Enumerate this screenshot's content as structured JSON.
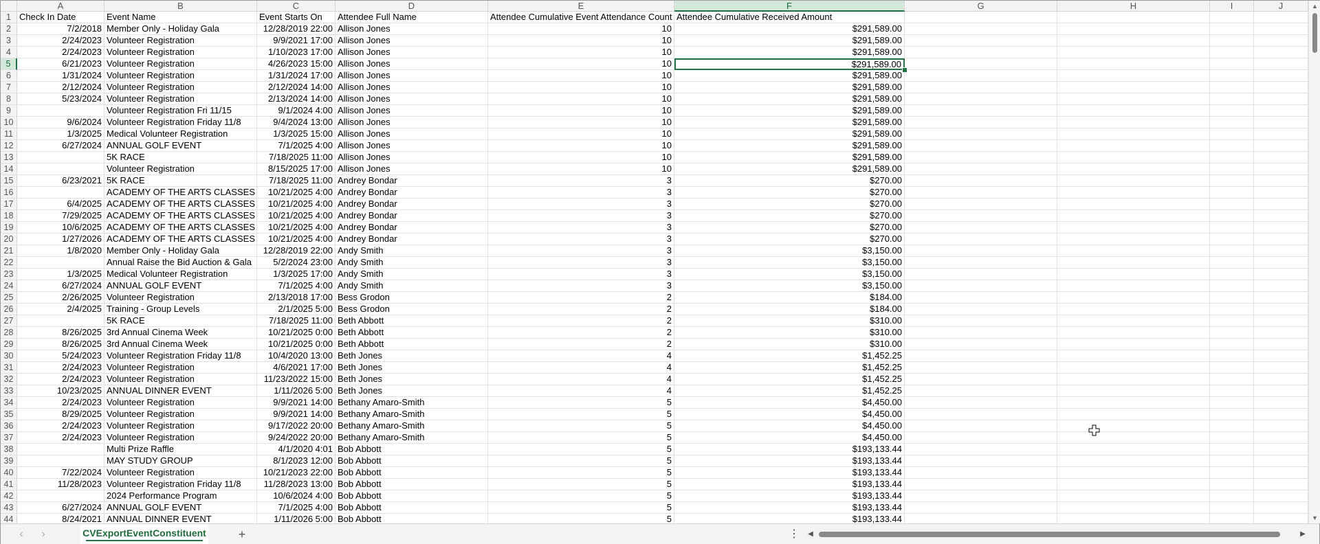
{
  "sheet": {
    "columns": [
      "A",
      "B",
      "C",
      "D",
      "E",
      "F",
      "G",
      "H",
      "I",
      "J"
    ],
    "active_column": "F",
    "active_row": "5",
    "selected_cell": "F5",
    "rows": [
      {
        "n": "1",
        "a": "Check In Date",
        "b": "Event Name",
        "c": "Event Starts On",
        "d": "Attendee Full Name",
        "e": "Attendee Cumulative Event Attendance Count",
        "f": "Attendee Cumulative Received Amount"
      },
      {
        "n": "2",
        "a": "7/2/2018",
        "b": "Member Only - Holiday Gala",
        "c": "12/28/2019 22:00",
        "d": "Allison Jones",
        "e": "10",
        "f": "$291,589.00"
      },
      {
        "n": "3",
        "a": "2/24/2023",
        "b": "Volunteer Registration",
        "c": "9/9/2021 17:00",
        "d": "Allison Jones",
        "e": "10",
        "f": "$291,589.00"
      },
      {
        "n": "4",
        "a": "2/24/2023",
        "b": "Volunteer Registration",
        "c": "1/10/2023 17:00",
        "d": "Allison Jones",
        "e": "10",
        "f": "$291,589.00"
      },
      {
        "n": "5",
        "a": "6/21/2023",
        "b": "Volunteer Registration",
        "c": "4/26/2023 15:00",
        "d": "Allison Jones",
        "e": "10",
        "f": "$291,589.00"
      },
      {
        "n": "6",
        "a": "1/31/2024",
        "b": "Volunteer Registration",
        "c": "1/31/2024 17:00",
        "d": "Allison Jones",
        "e": "10",
        "f": "$291,589.00"
      },
      {
        "n": "7",
        "a": "2/12/2024",
        "b": "Volunteer Registration",
        "c": "2/12/2024 14:00",
        "d": "Allison Jones",
        "e": "10",
        "f": "$291,589.00"
      },
      {
        "n": "8",
        "a": "5/23/2024",
        "b": "Volunteer Registration",
        "c": "2/13/2024 14:00",
        "d": "Allison Jones",
        "e": "10",
        "f": "$291,589.00"
      },
      {
        "n": "9",
        "a": "",
        "b": "Volunteer Registration Fri 11/15",
        "c": "9/1/2024 4:00",
        "d": "Allison Jones",
        "e": "10",
        "f": "$291,589.00"
      },
      {
        "n": "10",
        "a": "9/6/2024",
        "b": "Volunteer Registration Friday 11/8",
        "c": "9/4/2024 13:00",
        "d": "Allison Jones",
        "e": "10",
        "f": "$291,589.00"
      },
      {
        "n": "11",
        "a": "1/3/2025",
        "b": "Medical Volunteer Registration",
        "c": "1/3/2025 15:00",
        "d": "Allison Jones",
        "e": "10",
        "f": "$291,589.00"
      },
      {
        "n": "12",
        "a": "6/27/2024",
        "b": "ANNUAL GOLF EVENT",
        "c": "7/1/2025 4:00",
        "d": "Allison Jones",
        "e": "10",
        "f": "$291,589.00"
      },
      {
        "n": "13",
        "a": "",
        "b": "5K RACE",
        "c": "7/18/2025 11:00",
        "d": "Allison Jones",
        "e": "10",
        "f": "$291,589.00"
      },
      {
        "n": "14",
        "a": "",
        "b": "Volunteer Registration",
        "c": "8/15/2025 17:00",
        "d": "Allison Jones",
        "e": "10",
        "f": "$291,589.00"
      },
      {
        "n": "15",
        "a": "6/23/2021",
        "b": "5K RACE",
        "c": "7/18/2025 11:00",
        "d": "Andrey Bondar",
        "e": "3",
        "f": "$270.00"
      },
      {
        "n": "16",
        "a": "",
        "b": "ACADEMY OF THE ARTS CLASSES",
        "c": "10/21/2025 4:00",
        "d": "Andrey Bondar",
        "e": "3",
        "f": "$270.00"
      },
      {
        "n": "17",
        "a": "6/4/2025",
        "b": "ACADEMY OF THE ARTS CLASSES",
        "c": "10/21/2025 4:00",
        "d": "Andrey Bondar",
        "e": "3",
        "f": "$270.00"
      },
      {
        "n": "18",
        "a": "7/29/2025",
        "b": "ACADEMY OF THE ARTS CLASSES",
        "c": "10/21/2025 4:00",
        "d": "Andrey Bondar",
        "e": "3",
        "f": "$270.00"
      },
      {
        "n": "19",
        "a": "10/6/2025",
        "b": "ACADEMY OF THE ARTS CLASSES",
        "c": "10/21/2025 4:00",
        "d": "Andrey Bondar",
        "e": "3",
        "f": "$270.00"
      },
      {
        "n": "20",
        "a": "1/27/2026",
        "b": "ACADEMY OF THE ARTS CLASSES",
        "c": "10/21/2025 4:00",
        "d": "Andrey Bondar",
        "e": "3",
        "f": "$270.00"
      },
      {
        "n": "21",
        "a": "1/8/2020",
        "b": "Member Only - Holiday Gala",
        "c": "12/28/2019 22:00",
        "d": "Andy Smith",
        "e": "3",
        "f": "$3,150.00"
      },
      {
        "n": "22",
        "a": "",
        "b": "Annual Raise the Bid Auction & Gala",
        "c": "5/2/2024 23:00",
        "d": "Andy Smith",
        "e": "3",
        "f": "$3,150.00"
      },
      {
        "n": "23",
        "a": "1/3/2025",
        "b": "Medical Volunteer Registration",
        "c": "1/3/2025 17:00",
        "d": "Andy Smith",
        "e": "3",
        "f": "$3,150.00"
      },
      {
        "n": "24",
        "a": "6/27/2024",
        "b": "ANNUAL GOLF EVENT",
        "c": "7/1/2025 4:00",
        "d": "Andy Smith",
        "e": "3",
        "f": "$3,150.00"
      },
      {
        "n": "25",
        "a": "2/26/2025",
        "b": "Volunteer Registration",
        "c": "2/13/2018 17:00",
        "d": "Bess Grodon",
        "e": "2",
        "f": "$184.00"
      },
      {
        "n": "26",
        "a": "2/4/2025",
        "b": "Training - Group Levels",
        "c": "2/1/2025 5:00",
        "d": "Bess Grodon",
        "e": "2",
        "f": "$184.00"
      },
      {
        "n": "27",
        "a": "",
        "b": "5K RACE",
        "c": "7/18/2025 11:00",
        "d": "Beth Abbott",
        "e": "2",
        "f": "$310.00"
      },
      {
        "n": "28",
        "a": "8/26/2025",
        "b": "3rd Annual Cinema Week",
        "c": "10/21/2025 0:00",
        "d": "Beth Abbott",
        "e": "2",
        "f": "$310.00"
      },
      {
        "n": "29",
        "a": "8/26/2025",
        "b": "3rd Annual Cinema Week",
        "c": "10/21/2025 0:00",
        "d": "Beth Abbott",
        "e": "2",
        "f": "$310.00"
      },
      {
        "n": "30",
        "a": "5/24/2023",
        "b": "Volunteer Registration Friday 11/8",
        "c": "10/4/2020 13:00",
        "d": "Beth Jones",
        "e": "4",
        "f": "$1,452.25"
      },
      {
        "n": "31",
        "a": "2/24/2023",
        "b": "Volunteer Registration",
        "c": "4/6/2021 17:00",
        "d": "Beth Jones",
        "e": "4",
        "f": "$1,452.25"
      },
      {
        "n": "32",
        "a": "2/24/2023",
        "b": "Volunteer Registration",
        "c": "11/23/2022 15:00",
        "d": "Beth Jones",
        "e": "4",
        "f": "$1,452.25"
      },
      {
        "n": "33",
        "a": "10/23/2025",
        "b": "ANNUAL DINNER EVENT",
        "c": "1/11/2026 5:00",
        "d": "Beth Jones",
        "e": "4",
        "f": "$1,452.25"
      },
      {
        "n": "34",
        "a": "2/24/2023",
        "b": "Volunteer Registration",
        "c": "9/9/2021 14:00",
        "d": "Bethany Amaro-Smith",
        "e": "5",
        "f": "$4,450.00"
      },
      {
        "n": "35",
        "a": "8/29/2025",
        "b": "Volunteer Registration",
        "c": "9/9/2021 14:00",
        "d": "Bethany Amaro-Smith",
        "e": "5",
        "f": "$4,450.00"
      },
      {
        "n": "36",
        "a": "2/24/2023",
        "b": "Volunteer Registration",
        "c": "9/17/2022 20:00",
        "d": "Bethany Amaro-Smith",
        "e": "5",
        "f": "$4,450.00"
      },
      {
        "n": "37",
        "a": "2/24/2023",
        "b": "Volunteer Registration",
        "c": "9/24/2022 20:00",
        "d": "Bethany Amaro-Smith",
        "e": "5",
        "f": "$4,450.00"
      },
      {
        "n": "38",
        "a": "",
        "b": "Multi Prize Raffle",
        "c": "4/1/2020 4:01",
        "d": "Bob Abbott",
        "e": "5",
        "f": "$193,133.44"
      },
      {
        "n": "39",
        "a": "",
        "b": "MAY STUDY GROUP",
        "c": "8/1/2023 12:00",
        "d": "Bob Abbott",
        "e": "5",
        "f": "$193,133.44"
      },
      {
        "n": "40",
        "a": "7/22/2024",
        "b": "Volunteer Registration",
        "c": "10/21/2023 22:00",
        "d": "Bob Abbott",
        "e": "5",
        "f": "$193,133.44"
      },
      {
        "n": "41",
        "a": "11/28/2023",
        "b": "Volunteer Registration Friday 11/8",
        "c": "11/28/2023 13:00",
        "d": "Bob Abbott",
        "e": "5",
        "f": "$193,133.44"
      },
      {
        "n": "42",
        "a": "",
        "b": "2024 Performance Program",
        "c": "10/6/2024 4:00",
        "d": "Bob Abbott",
        "e": "5",
        "f": "$193,133.44"
      },
      {
        "n": "43",
        "a": "6/27/2024",
        "b": "ANNUAL GOLF EVENT",
        "c": "7/1/2025 4:00",
        "d": "Bob Abbott",
        "e": "5",
        "f": "$193,133.44"
      },
      {
        "n": "44",
        "a": "8/24/2021",
        "b": "ANNUAL DINNER EVENT",
        "c": "1/11/2026 5:00",
        "d": "Bob Abbott",
        "e": "5",
        "f": "$193,133.44"
      }
    ]
  },
  "tabs": {
    "sheet_name": "CVExportEventConstituent",
    "add_label": "+"
  },
  "icons": {
    "scroll_up": "scroll-up-arrow-icon",
    "scroll_down": "scroll-down-arrow-icon",
    "scroll_left": "scroll-left-arrow-icon",
    "scroll_right": "scroll-right-arrow-icon",
    "prev_sheet": "chevron-left-icon",
    "next_sheet": "chevron-right-icon",
    "more": "more-options-icon",
    "cursor": "cell-select-cursor-icon"
  },
  "colors": {
    "accent": "#217346",
    "header_bg": "#f3f3f3",
    "grid_line": "#e1e1e1"
  }
}
